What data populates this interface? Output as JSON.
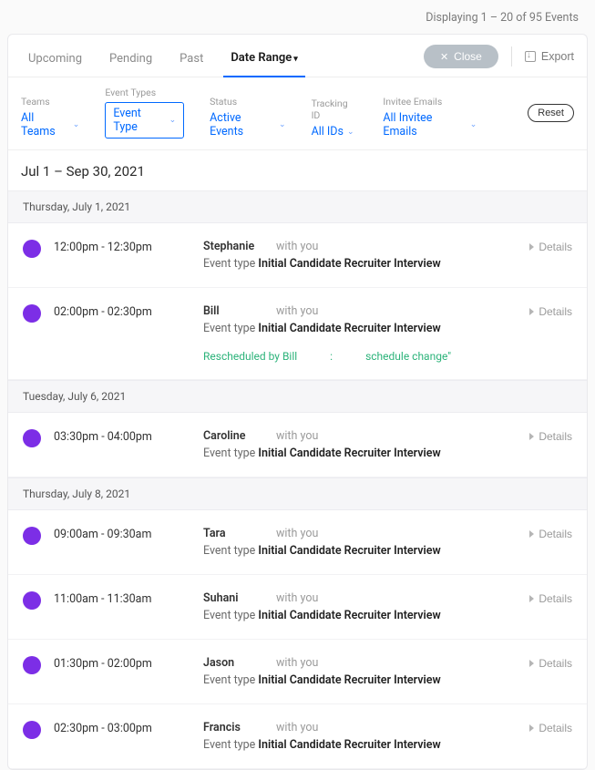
{
  "status_line": "Displaying 1 – 20 of 95 Events",
  "tabs": {
    "upcoming": "Upcoming",
    "pending": "Pending",
    "past": "Past",
    "date_range": "Date Range"
  },
  "close_label": "Close",
  "export_label": "Export",
  "filters": {
    "teams": {
      "label": "Teams",
      "value": "All Teams"
    },
    "event_types": {
      "label": "Event Types",
      "value": "Event Type"
    },
    "status": {
      "label": "Status",
      "value": "Active Events"
    },
    "tracking_id": {
      "label": "Tracking ID",
      "value": "All IDs"
    },
    "invitee_emails": {
      "label": "Invitee Emails",
      "value": "All Invitee Emails"
    }
  },
  "reset_label": "Reset",
  "date_range_header": "Jul 1 – Sep 30, 2021",
  "with_you": "with you",
  "event_type_label": "Event type",
  "details_label": "Details",
  "days": [
    {
      "header": "Thursday, July 1, 2021",
      "events": [
        {
          "time": "12:00pm - 12:30pm",
          "name": "Stephanie",
          "event_type": "Initial Candidate Recruiter Interview"
        },
        {
          "time": "02:00pm - 02:30pm",
          "name": "Bill",
          "event_type": "Initial Candidate Recruiter Interview",
          "rescheduled": {
            "by": "Rescheduled by Bill",
            "sep": ":",
            "reason": "schedule change\""
          }
        }
      ]
    },
    {
      "header": "Tuesday, July 6, 2021",
      "events": [
        {
          "time": "03:30pm - 04:00pm",
          "name": "Caroline",
          "event_type": "Initial Candidate Recruiter Interview"
        }
      ]
    },
    {
      "header": "Thursday, July 8, 2021",
      "events": [
        {
          "time": "09:00am - 09:30am",
          "name": "Tara",
          "event_type": "Initial Candidate Recruiter Interview"
        },
        {
          "time": "11:00am - 11:30am",
          "name": "Suhani",
          "event_type": "Initial Candidate Recruiter Interview"
        },
        {
          "time": "01:30pm - 02:00pm",
          "name": "Jason",
          "event_type": "Initial Candidate Recruiter Interview"
        },
        {
          "time": "02:30pm - 03:00pm",
          "name": "Francis",
          "event_type": "Initial Candidate Recruiter Interview"
        }
      ]
    }
  ]
}
